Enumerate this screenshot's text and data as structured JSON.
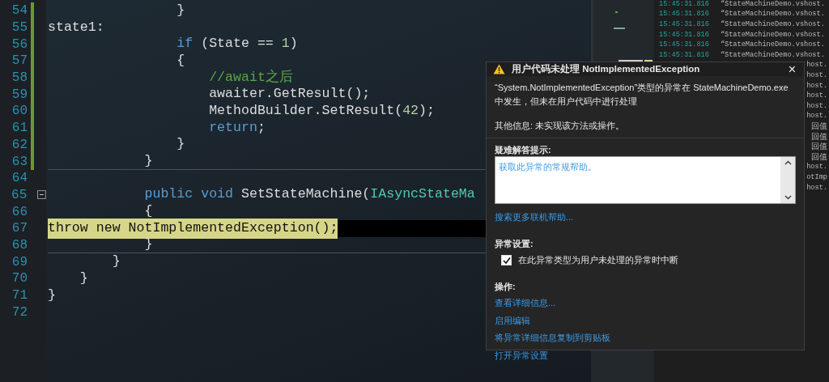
{
  "code_lines": [
    {
      "number": "54",
      "changed": true,
      "tokens": [
        {
          "kind": "plain",
          "text": "                }"
        }
      ]
    },
    {
      "number": "55",
      "changed": true,
      "tokens": [
        {
          "kind": "plain",
          "text": "state1:"
        }
      ]
    },
    {
      "number": "56",
      "changed": true,
      "tokens": [
        {
          "kind": "keyword",
          "text": "                if"
        },
        {
          "kind": "plain",
          "text": " (State == "
        },
        {
          "kind": "number",
          "text": "1"
        },
        {
          "kind": "plain",
          "text": ")"
        }
      ]
    },
    {
      "number": "57",
      "changed": true,
      "tokens": [
        {
          "kind": "plain",
          "text": "                {"
        }
      ]
    },
    {
      "number": "58",
      "changed": true,
      "tokens": [
        {
          "kind": "comment",
          "text": "                    //await之后"
        }
      ]
    },
    {
      "number": "59",
      "changed": true,
      "tokens": [
        {
          "kind": "plain",
          "text": "                    awaiter.GetResult();"
        }
      ]
    },
    {
      "number": "60",
      "changed": true,
      "tokens": [
        {
          "kind": "plain",
          "text": "                    MethodBuilder.SetResult("
        },
        {
          "kind": "number",
          "text": "42"
        },
        {
          "kind": "plain",
          "text": ");"
        }
      ]
    },
    {
      "number": "61",
      "changed": true,
      "tokens": [
        {
          "kind": "keyword",
          "text": "                    return"
        },
        {
          "kind": "plain",
          "text": ";"
        }
      ]
    },
    {
      "number": "62",
      "changed": true,
      "tokens": [
        {
          "kind": "plain",
          "text": "                }"
        }
      ]
    },
    {
      "number": "63",
      "changed": true,
      "separator": true,
      "tokens": [
        {
          "kind": "plain",
          "text": "            }"
        }
      ]
    },
    {
      "number": "64"
    },
    {
      "number": "65",
      "foldable": true,
      "tokens": [
        {
          "kind": "keyword",
          "text": "            public void"
        },
        {
          "kind": "plain",
          "text": " SetStateMachine("
        },
        {
          "kind": "type",
          "text": "IAsyncStateMa"
        }
      ]
    },
    {
      "number": "66",
      "tokens": [
        {
          "kind": "plain",
          "text": "            {"
        }
      ]
    },
    {
      "number": "67",
      "current": true,
      "tokens": [
        {
          "kind": "statement",
          "text": "                throw new NotImplementedException();"
        }
      ]
    },
    {
      "number": "68",
      "separator": true,
      "tokens": [
        {
          "kind": "plain",
          "text": "            }"
        }
      ]
    },
    {
      "number": "69",
      "tokens": [
        {
          "kind": "plain",
          "text": "        }"
        }
      ]
    },
    {
      "number": "70",
      "tokens": [
        {
          "kind": "plain",
          "text": "    }"
        }
      ]
    },
    {
      "number": "71",
      "tokens": [
        {
          "kind": "plain",
          "text": "}"
        }
      ]
    },
    {
      "number": "72"
    }
  ],
  "output": [
    {
      "kind": "full",
      "time": "15:45:31.816",
      "text": "“StateMachineDemo.vshost."
    },
    {
      "kind": "full",
      "time": "15:45:31.816",
      "text": "“StateMachineDemo.vshost."
    },
    {
      "kind": "full",
      "time": "15:45:31.816",
      "text": "“StateMachineDemo.vshost."
    },
    {
      "kind": "full",
      "time": "15:45:31.816",
      "text": "“StateMachineDemo.vshost."
    },
    {
      "kind": "full",
      "time": "15:45:31.816",
      "text": "“StateMachineDemo.vshost."
    },
    {
      "kind": "full",
      "time": "15:45:31.816",
      "text": "“StateMachineDemo.vshost."
    },
    {
      "kind": "fragment",
      "text": "host."
    },
    {
      "kind": "fragment",
      "text": "host."
    },
    {
      "kind": "fragment",
      "text": "host."
    },
    {
      "kind": "fragment",
      "text": "host."
    },
    {
      "kind": "fragment",
      "text": "host."
    },
    {
      "kind": "fragment",
      "text": "host."
    },
    {
      "kind": "fragment",
      "text": "回值"
    },
    {
      "kind": "fragment",
      "text": "回值"
    },
    {
      "kind": "fragment",
      "text": "回值"
    },
    {
      "kind": "fragment",
      "text": "回值"
    },
    {
      "kind": "fragment",
      "text": "host."
    },
    {
      "kind": "fragment",
      "text": "otImp"
    },
    {
      "kind": "fragment",
      "text": "host."
    }
  ],
  "exception_popup": {
    "title": "用户代码未处理 NotImplementedException",
    "close": "×",
    "message": "“System.NotImplementedException”类型的异常在 StateMachineDemo.exe 中发生，但未在用户代码中进行处理",
    "additional_info": "其他信息: 未实现该方法或操作。",
    "troubleshooting_heading": "疑难解答提示:",
    "troubleshooting_link": "获取此异常的常规帮助。",
    "search_link": "搜索更多联机帮助...",
    "settings_heading": "异常设置:",
    "break_option": {
      "label": "在此异常类型为用户未处理的异常时中断",
      "checked": true
    },
    "actions_heading": "操作:",
    "actions": [
      "查看详细信息...",
      "启用编辑",
      "将异常详细信息复制到剪贴板",
      "打开异常设置"
    ]
  }
}
